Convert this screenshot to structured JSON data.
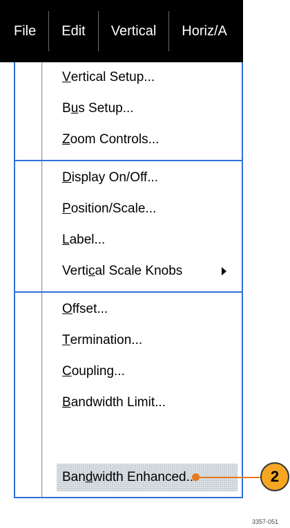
{
  "menubar": {
    "items": [
      {
        "label": "File"
      },
      {
        "label": "Edit"
      },
      {
        "label": "Vertical"
      },
      {
        "label": "Horiz/A"
      }
    ]
  },
  "menu": {
    "sections": [
      {
        "items": [
          {
            "pre": "",
            "u": "V",
            "post": "ertical Setup..."
          },
          {
            "pre": "B",
            "u": "u",
            "post": "s Setup..."
          },
          {
            "pre": "",
            "u": "Z",
            "post": "oom Controls..."
          }
        ]
      },
      {
        "items": [
          {
            "pre": "",
            "u": "D",
            "post": "isplay On/Off..."
          },
          {
            "pre": "",
            "u": "P",
            "post": "osition/Scale..."
          },
          {
            "pre": "",
            "u": "L",
            "post": "abel..."
          },
          {
            "pre": "Verti",
            "u": "c",
            "post": "al Scale Knobs"
          }
        ]
      },
      {
        "items": [
          {
            "pre": "",
            "u": "O",
            "post": "ffset..."
          },
          {
            "pre": "",
            "u": "T",
            "post": "ermination..."
          },
          {
            "pre": "",
            "u": "C",
            "post": "oupling..."
          },
          {
            "pre": "",
            "u": "B",
            "post": "andwidth Limit..."
          },
          {
            "pre": "Ban",
            "u": "d",
            "post": "width Enhanced..."
          }
        ]
      }
    ]
  },
  "callout": {
    "number": "2",
    "color": "#f5a623"
  },
  "figure_id": "3357-051",
  "colors": {
    "accent": "#2f6fd6",
    "callout_line": "#e87a1a"
  }
}
